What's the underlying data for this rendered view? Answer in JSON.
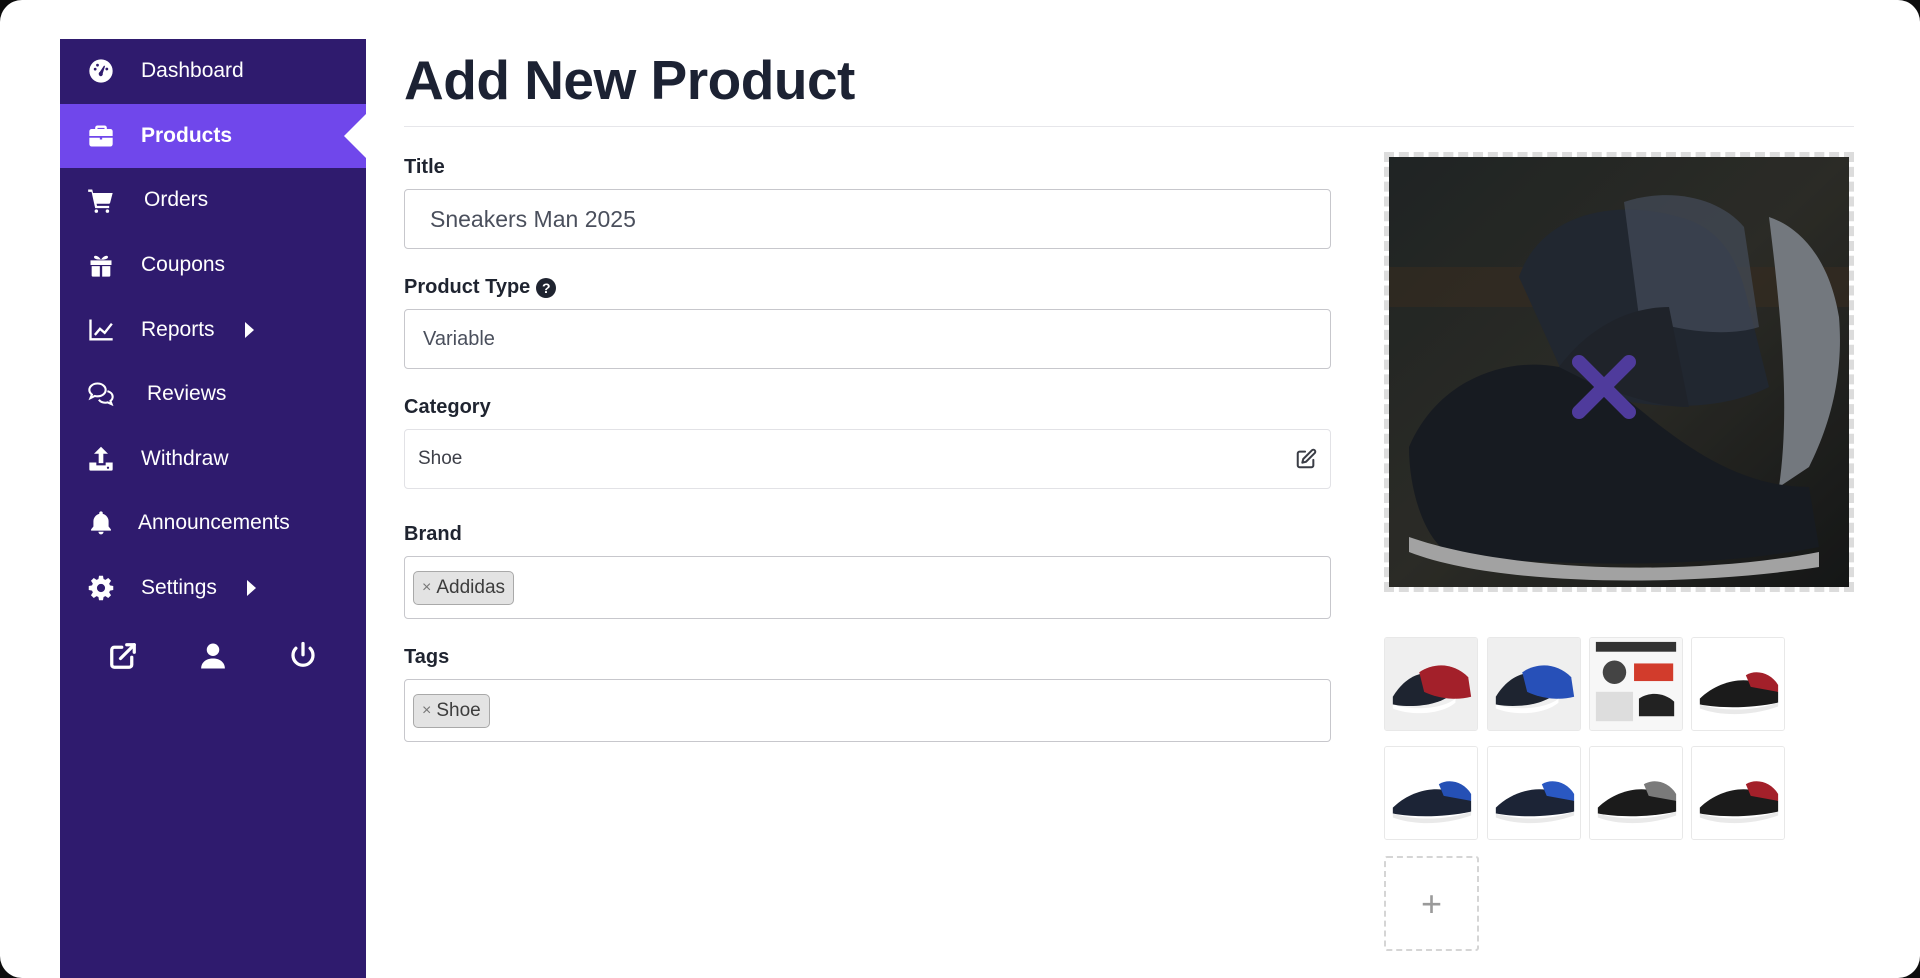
{
  "sidebar": {
    "items": [
      {
        "label": "Dashboard",
        "icon": "dashboard-icon"
      },
      {
        "label": "Products",
        "icon": "briefcase-icon",
        "active": true
      },
      {
        "label": "Orders",
        "icon": "cart-icon"
      },
      {
        "label": "Coupons",
        "icon": "gift-icon"
      },
      {
        "label": "Reports",
        "icon": "chart-line-icon",
        "submenu": true
      },
      {
        "label": "Reviews",
        "icon": "comments-icon"
      },
      {
        "label": "Withdraw",
        "icon": "upload-icon"
      },
      {
        "label": "Announcements",
        "icon": "bell-icon"
      },
      {
        "label": "Settings",
        "icon": "gear-icon",
        "submenu": true
      }
    ],
    "footer": [
      "external-link-icon",
      "user-icon",
      "power-icon"
    ]
  },
  "page": {
    "title": "Add New Product"
  },
  "form": {
    "title": {
      "label": "Title",
      "value": "Sneakers Man 2025"
    },
    "product_type": {
      "label": "Product Type",
      "help": "?",
      "value": "Variable"
    },
    "category": {
      "label": "Category",
      "value": "Shoe"
    },
    "brand": {
      "label": "Brand",
      "tags": [
        "Addidas"
      ]
    },
    "tags": {
      "label": "Tags",
      "tags": [
        "Shoe"
      ]
    }
  },
  "gallery": {
    "remove_mark": "×",
    "add_label": "+",
    "thumbnails": [
      "red-sneaker-pair",
      "blue-sneaker-pair",
      "infographic",
      "red-sneaker",
      "blue-sneaker",
      "blue-sneaker",
      "grey-sneaker",
      "red-sneaker"
    ]
  },
  "colors": {
    "sidebar": "#2f1b6e",
    "accent": "#7047eb",
    "title": "#1c2233"
  }
}
